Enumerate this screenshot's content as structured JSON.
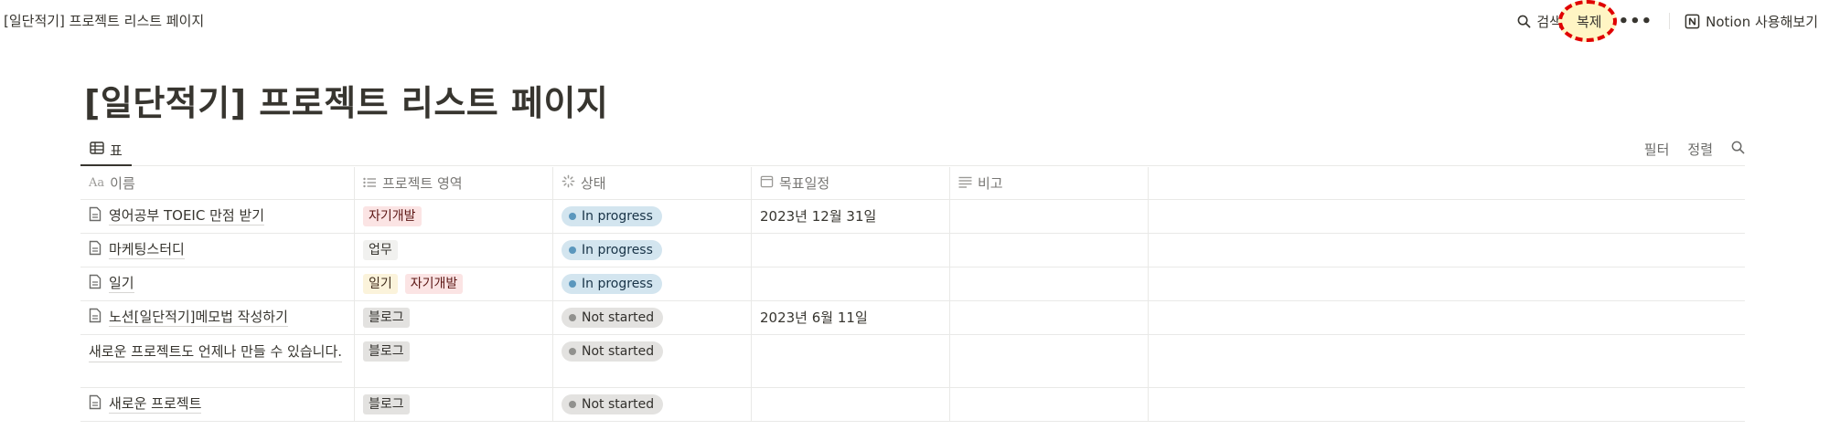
{
  "topbar": {
    "breadcrumb": "[일단적기] 프로젝트 리스트 페이지",
    "search_label": "검색",
    "duplicate_label": "복제",
    "more_label": "•••",
    "notion_label": "Notion 사용해보기"
  },
  "page": {
    "title": "[일단적기] 프로젝트 리스트 페이지"
  },
  "view": {
    "tab_label": "표",
    "filter_label": "필터",
    "sort_label": "정렬"
  },
  "table": {
    "columns": {
      "name": "이름",
      "area": "프로젝트 영역",
      "status": "상태",
      "date": "목표일정",
      "note": "비고"
    },
    "name_prefix": "Aa",
    "rows": [
      {
        "name": "영어공부 TOEIC 만점 받기",
        "tag1": "자기개발",
        "tag2": "",
        "status": "In progress",
        "date": "2023년 12월 31일"
      },
      {
        "name": "마케팅스터디",
        "tag1": "업무",
        "tag2": "",
        "status": "In progress",
        "date": ""
      },
      {
        "name": "일기",
        "tag1": "일기",
        "tag2": "자기개발",
        "status": "In progress",
        "date": ""
      },
      {
        "name": "노션[일단적기]메모법 작성하기",
        "tag1": "블로그",
        "tag2": "",
        "status": "Not started",
        "date": "2023년 6월 11일"
      },
      {
        "name": "새로운 프로젝트도 언제나 만들 수 있습니다.",
        "tag1": "블로그",
        "tag2": "",
        "status": "Not started",
        "date": ""
      },
      {
        "name": "새로운 프로젝트",
        "tag1": "블로그",
        "tag2": "",
        "status": "Not started",
        "date": ""
      }
    ]
  },
  "colors": {
    "highlight_circle": "#e00000",
    "tag_self_dev": "#fbe4e4",
    "tag_work": "#f1f1ef",
    "tag_diary": "#fbf3db",
    "tag_blog": "#e3e2e0",
    "status_in_progress": "#d3e5ef",
    "status_not_started": "#e3e2e0"
  }
}
